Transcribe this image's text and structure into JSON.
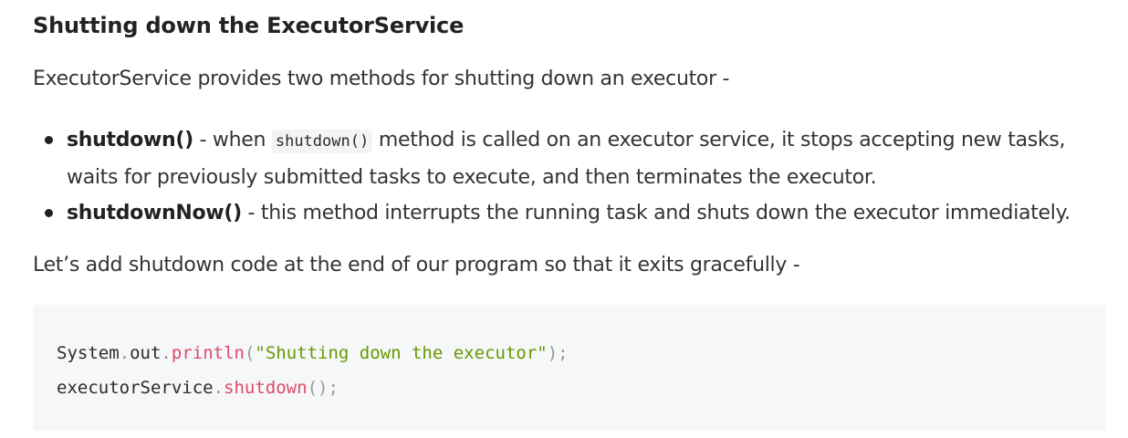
{
  "article": {
    "heading": "Shutting down the ExecutorService",
    "intro": "ExecutorService provides two methods for shutting down an executor -",
    "bullets": [
      {
        "term": "shutdown()",
        "text_before_code": " - when ",
        "inline_code": "shutdown()",
        "text_after_code": " method is called on an executor service, it stops accepting new tasks, waits for previously submitted tasks to execute, and then terminates the executor."
      },
      {
        "term": "shutdownNow()",
        "text": " - this method interrupts the running task and shuts down the executor immediately."
      }
    ],
    "outro": "Let’s add shutdown code at the end of our program so that it exits gracefully -"
  },
  "code_block": {
    "language": "java",
    "lines": [
      {
        "obj": "System",
        "dot1": ".",
        "field": "out",
        "dot2": ".",
        "method": "println",
        "open": "(",
        "arg": "\"Shutting down the executor\"",
        "close": ");"
      },
      {
        "obj": "executorService",
        "dot1": ".",
        "method": "shutdown",
        "open": "(",
        "close": ");"
      }
    ]
  },
  "colors": {
    "text": "#333333",
    "heading": "#222222",
    "code_background": "#f6f7f9",
    "inline_code_background": "#f3f4f6",
    "token_function": "#dd4a68",
    "token_string": "#669900",
    "token_punctuation": "#999999"
  }
}
